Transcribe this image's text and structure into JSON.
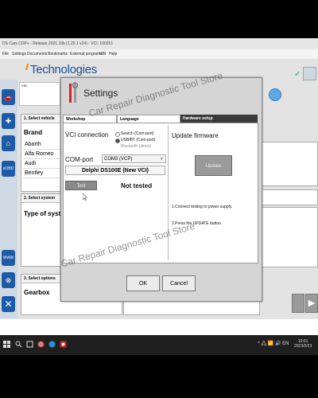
{
  "titlebar": {
    "text": "DS Cars CDP+ - Release 2021.10b (1.20.1 v24) - VCI: 100251"
  },
  "menubar": [
    "File",
    "Settings",
    "Documents",
    "Bookmarks",
    "External programs",
    "VIN",
    "Help"
  ],
  "app": {
    "brand": "Technologies",
    "vin_label": "VIN"
  },
  "panels": {
    "select_vehicle": {
      "header": "1. Select vehicle",
      "brand_label": "Brand",
      "brands": [
        "Abarth",
        "Alfa Romeo",
        "Audi",
        "Bentley"
      ]
    },
    "select_system": {
      "header": "2. Select system",
      "type_label": "Type of system"
    },
    "select_options": {
      "header": "3. Select options",
      "gearbox_label": "Gearbox"
    }
  },
  "dialog": {
    "title": "Settings",
    "tabs": [
      "Workshop",
      "Language",
      "Hardware setup"
    ],
    "vci_label": "VCI connection",
    "radio_search": "Search (Com-port)",
    "radio_usb": "USB/BT (Com-port)",
    "bluetooth": "Bluetooth (direct)",
    "comport_label": "COM-port",
    "comport_value": "COM3 (VCP)",
    "device": "Delphi DS100E (New VCI)",
    "test_button": "Test",
    "test_status": "Not tested",
    "update_title": "Update firmware",
    "update_button": "Update",
    "instruction1": "1.Connect testing to power supply.",
    "instruction2": "2.Press the UPDATE button.",
    "ok_button": "OK",
    "cancel_button": "Cancel"
  },
  "watermark": "Car Repair Diagnostic Tool Store",
  "taskbar": {
    "tray": "^ 🖧 📶 🔊 EN",
    "time": "10:01",
    "date": "2023/2/23"
  },
  "colors": {
    "brand_blue": "#1d4f8f",
    "sidebar_blue": "#1d5aa8",
    "taskbar": "#1f1f1f"
  }
}
